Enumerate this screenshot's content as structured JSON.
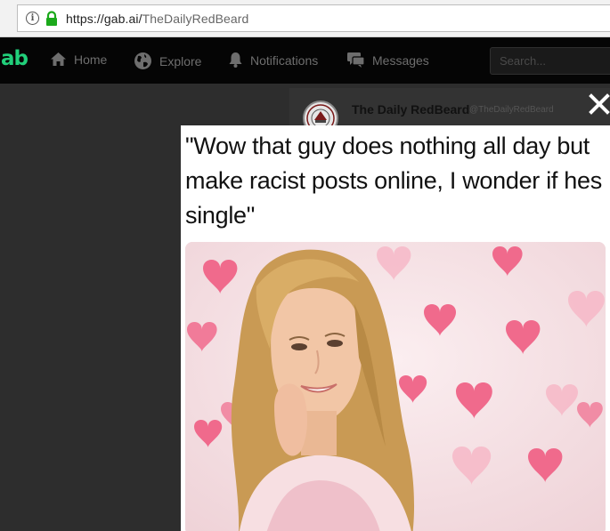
{
  "browser": {
    "url_domain": "https://gab.ai/",
    "url_path": "TheDailyRedBeard"
  },
  "navbar": {
    "logo": "ab",
    "items": [
      {
        "label": "Home",
        "icon": "home-icon"
      },
      {
        "label": "Explore",
        "icon": "globe-icon"
      },
      {
        "label": "Notifications",
        "icon": "bell-icon"
      },
      {
        "label": "Messages",
        "icon": "chat-icon"
      }
    ],
    "search_placeholder": "Search..."
  },
  "post": {
    "author_name": "The Daily RedBeard",
    "author_handle": "@TheDailyRedBeard"
  },
  "modal": {
    "caption": "\"Wow that guy does nothing all day but make racist posts online, I wonder if hes single\""
  },
  "colors": {
    "brand": "#21cf7a",
    "navbar_bg": "#050505",
    "overlay_bg": "#2d2d2d",
    "heart": "#f06a8c"
  }
}
